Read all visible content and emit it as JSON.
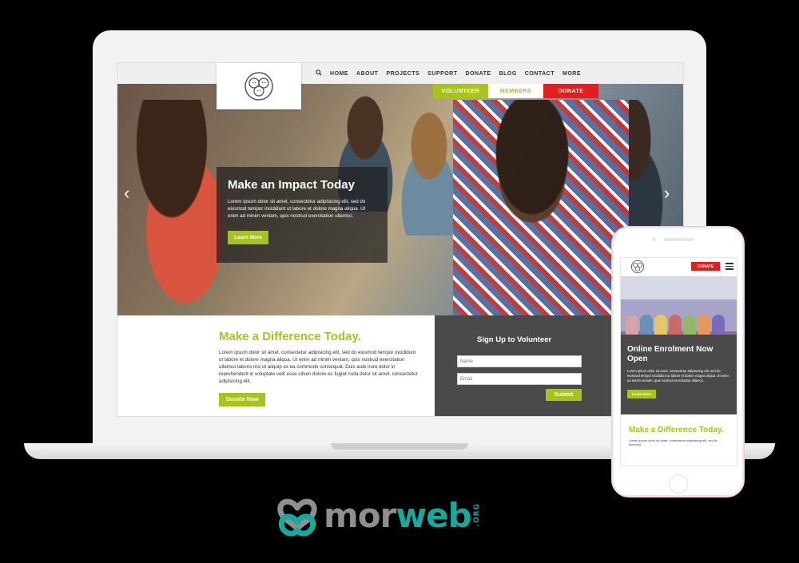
{
  "nav": {
    "items": [
      "HOME",
      "ABOUT",
      "PROJECTS",
      "SUPPORT",
      "DONATE",
      "BLOG",
      "CONTACT",
      "MORE"
    ],
    "cta": {
      "volunteer": "VOLUNTEER",
      "members": "MEMBERS",
      "donate": "DONATE"
    }
  },
  "hero": {
    "title": "Make an Impact Today",
    "text": "Lorem ipsum dolor sit amet, consectetur adipisicing elit, sed do eiusmod tempor incididunt ut labore et dolore magna aliqua. Ut enim ad minim veniam, quis nostrud exercitation ullamco.",
    "button": "Learn More"
  },
  "difference": {
    "title": "Make a Difference Today.",
    "text": "Lorem ipsum dolor sit amet, consectetur adipisicing elit, sed do eiusmod tempor incididunt ut labore et dolore magna aliqua. Ut enim ad minim veniam, quis nostrud exercitation ullamco laboris nisi ut aliquip ex ea commodo consequat. Duis aute irure dolor in reprehenderit in voluptate velit esse cillum dolore eu fugiat nulla dolor sit amet, consectetur adipisicing elit.",
    "button": "Donate Now"
  },
  "volunteer": {
    "title": "Sign Up to Volunteer",
    "name_placeholder": "Name",
    "email_placeholder": "Email",
    "submit": "Submit"
  },
  "phone": {
    "donate": "DONATE",
    "card_title": "Online Enrolment Now Open",
    "card_text": "Lorem ipsum dolor sit amet, consectetur adipisicing elit, sed do eiusmod tempor incididunt ut labore et dolore magna aliqua. Ut enim ad minim veniam, quis nostrud exercitation ullamco.",
    "card_button": "Learn More",
    "bottom_title": "Make a Difference Today.",
    "bottom_text": "Lorem ipsum dolor sit amet, consectetur adipisicing elit, sed do eiusmod"
  },
  "brand": {
    "mor": "mor",
    "web": "web",
    "org": ".ORG"
  },
  "colors": {
    "accent": "#a8c41c",
    "danger": "#e02020",
    "dark": "#4a4a4a",
    "brand_teal": "#16a99e",
    "brand_grey": "#8f8f8f"
  }
}
